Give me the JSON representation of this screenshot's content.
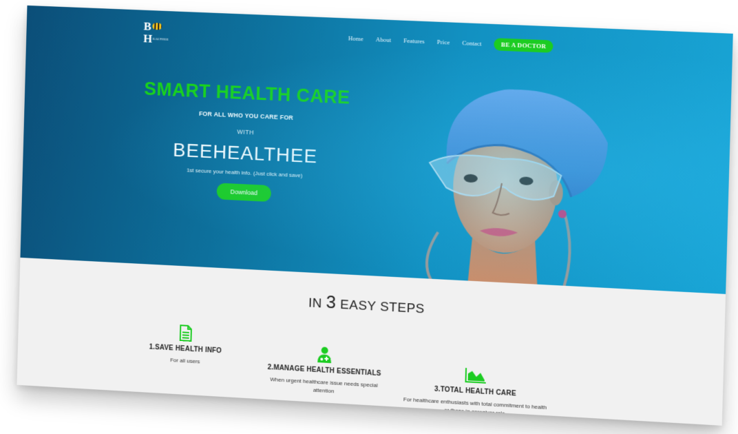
{
  "nav": {
    "logo": {
      "b": "B",
      "h": "H",
      "small": "EALTHEE"
    },
    "links": [
      "Home",
      "About",
      "Features",
      "Price",
      "Contact"
    ],
    "cta": "BE A DOCTOR"
  },
  "hero": {
    "headline": "SMART HEALTH CARE",
    "subhead": "FOR ALL WHO YOU CARE FOR",
    "with": "WITH",
    "brand": "BEEHEALTHEE",
    "tagline": "1st secure your health info. (Just click and save)",
    "download": "Download"
  },
  "steps": {
    "title_prefix": "IN",
    "title_num": "3",
    "title_suffix": "EASY STEPS",
    "items": [
      {
        "icon": "document-icon",
        "title": "1.SAVE HEALTH INFO",
        "desc": "For all users"
      },
      {
        "icon": "doctor-icon",
        "title": "2.MANAGE HEALTH ESSENTIALS",
        "desc": "When urgent healthcare issue needs special attention"
      },
      {
        "icon": "area-chart-icon",
        "title": "3.TOTAL HEALTH CARE",
        "desc": "For healthcare enthusiasts with total commitment to health or those in caregiver role"
      }
    ]
  },
  "colors": {
    "accent_green": "#1ccc22",
    "hero_blue": "#1291c2",
    "hero_dark": "#0b4e78"
  }
}
